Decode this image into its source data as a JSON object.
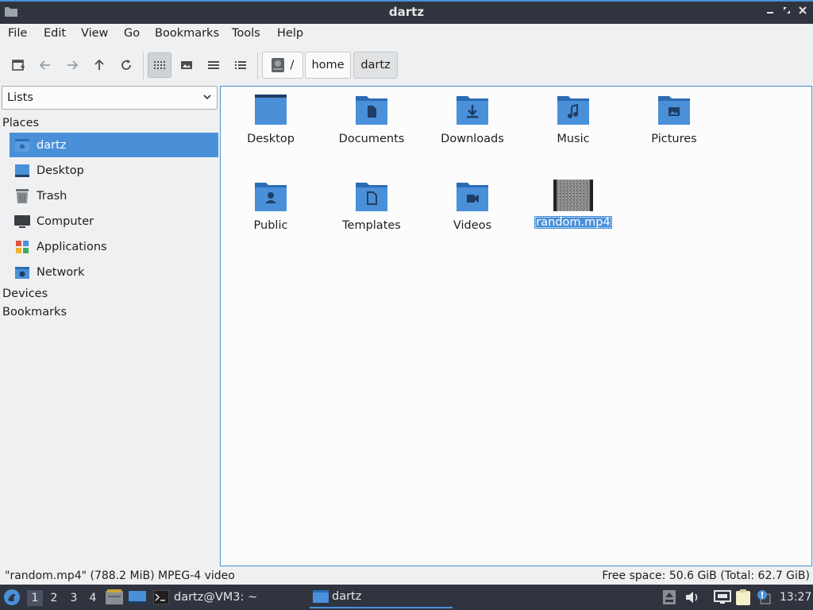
{
  "window": {
    "title": "dartz"
  },
  "menu": [
    "File",
    "Edit",
    "View",
    "Go",
    "Bookmarks",
    "Tools",
    "Help"
  ],
  "breadcrumb": {
    "root": "/",
    "items": [
      "home",
      "dartz"
    ]
  },
  "sidebar": {
    "selector": "Lists",
    "places_label": "Places",
    "places": [
      "dartz",
      "Desktop",
      "Trash",
      "Computer",
      "Applications",
      "Network"
    ],
    "devices_label": "Devices",
    "bookmarks_label": "Bookmarks"
  },
  "files": [
    {
      "name": "Desktop",
      "icon": "folder-desktop-icon"
    },
    {
      "name": "Documents",
      "icon": "folder-documents-icon"
    },
    {
      "name": "Downloads",
      "icon": "folder-downloads-icon"
    },
    {
      "name": "Music",
      "icon": "folder-music-icon"
    },
    {
      "name": "Pictures",
      "icon": "folder-pictures-icon"
    },
    {
      "name": "Public",
      "icon": "folder-public-icon"
    },
    {
      "name": "Templates",
      "icon": "folder-templates-icon"
    },
    {
      "name": "Videos",
      "icon": "folder-videos-icon"
    },
    {
      "name": "random.mp4",
      "icon": "video-thumbnail-icon",
      "selected": true
    }
  ],
  "status": {
    "left": "\"random.mp4\" (788.2 MiB) MPEG-4 video",
    "right": "Free space: 50.6 GiB (Total: 62.7 GiB)"
  },
  "taskbar": {
    "workspaces": [
      "1",
      "2",
      "3",
      "4"
    ],
    "tasks": [
      "dartz@VM3: ~",
      "dartz"
    ],
    "clock": "13:27"
  },
  "colors": {
    "accent": "#4a90d9",
    "titlebar": "#2f343f",
    "folder": "#4a90d9"
  }
}
